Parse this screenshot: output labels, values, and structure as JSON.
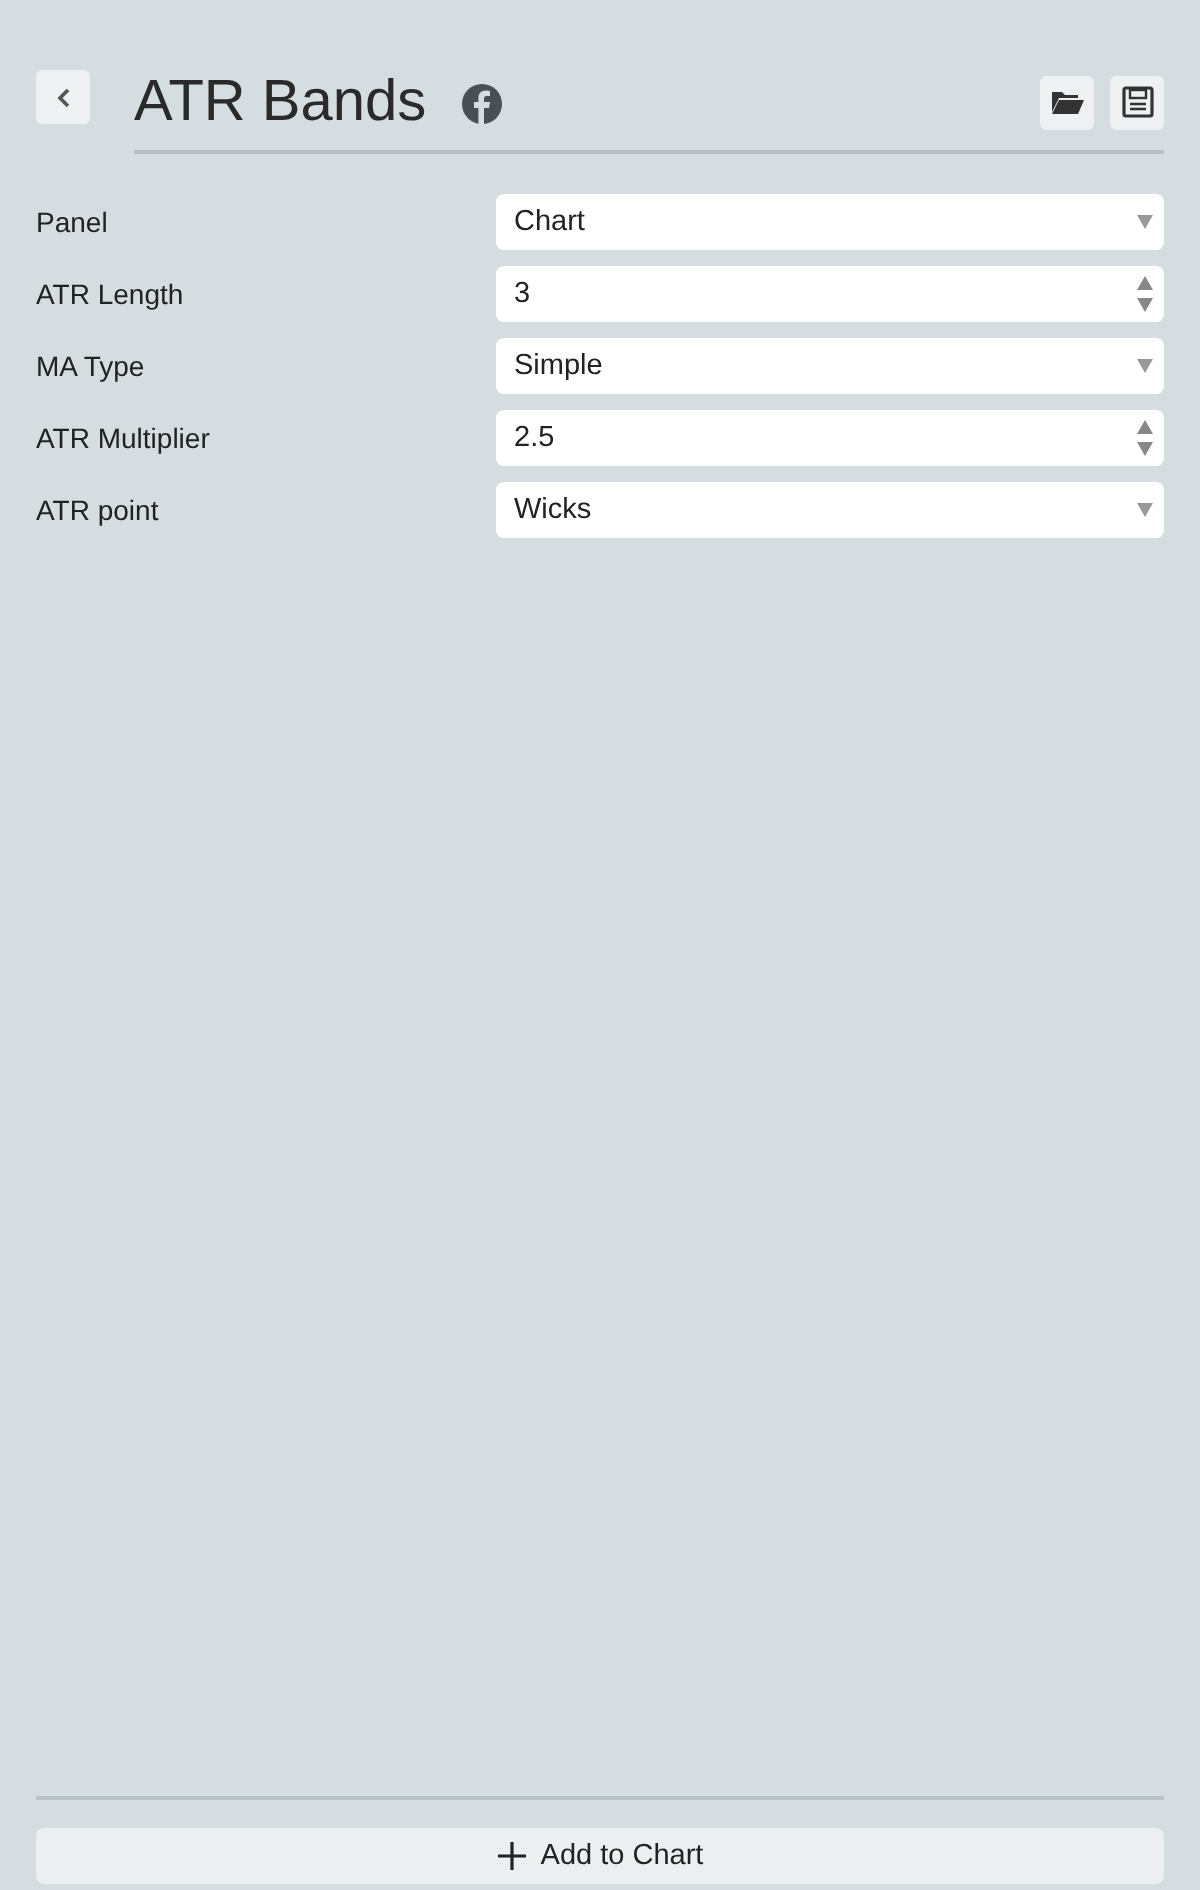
{
  "header": {
    "title": "ATR Bands"
  },
  "fields": [
    {
      "label": "Panel",
      "kind": "select",
      "value": "Chart"
    },
    {
      "label": "ATR Length",
      "kind": "number",
      "value": "3"
    },
    {
      "label": "MA Type",
      "kind": "select",
      "value": "Simple"
    },
    {
      "label": "ATR Multiplier",
      "kind": "number",
      "value": "2.5"
    },
    {
      "label": "ATR point",
      "kind": "select",
      "value": "Wicks"
    }
  ],
  "footer": {
    "button": "Add to Chart"
  }
}
